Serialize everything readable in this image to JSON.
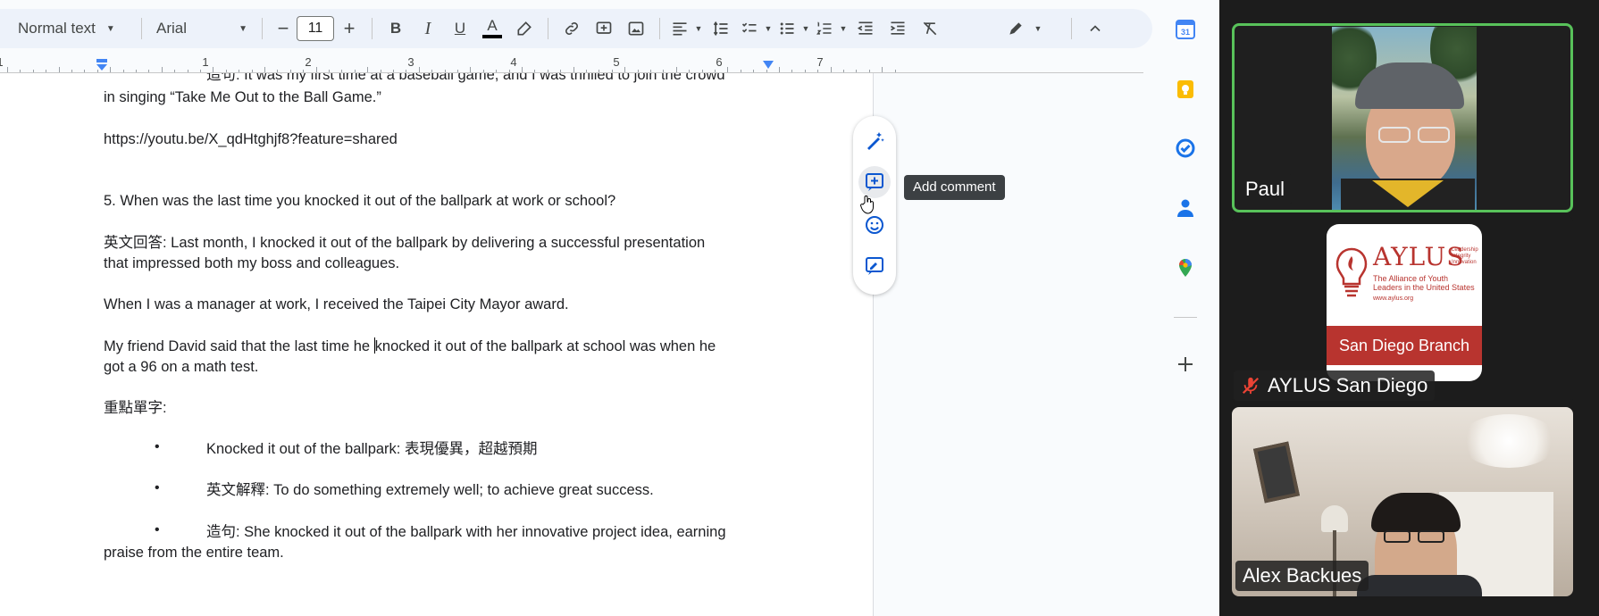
{
  "toolbar": {
    "style": "Normal text",
    "font": "Arial",
    "font_size": "11",
    "decrease": "−",
    "increase": "+",
    "bold": "B",
    "italic": "I",
    "underline": "U",
    "text_color_glyph": "A",
    "icons": [
      "bold-icon",
      "italic-icon",
      "underline-icon",
      "text-color-icon",
      "highlight-icon",
      "link-icon",
      "insert-comment-icon",
      "insert-image-icon",
      "align-icon",
      "line-spacing-icon",
      "checklist-icon",
      "bullet-list-icon",
      "numbered-list-icon",
      "decrease-indent-icon",
      "increase-indent-icon",
      "clear-formatting-icon",
      "editing-mode-icon",
      "collapse-toolbar-icon"
    ],
    "text_color": "#000000"
  },
  "ruler": {
    "numbers": [
      "1",
      "1",
      "2",
      "3",
      "4",
      "5",
      "6",
      "7"
    ]
  },
  "document": {
    "line_top_cut": "造句: It was my first time at a baseball game, and I was thrilled to join the crowd",
    "line_1": "in singing “Take Me Out to the Ball Game.”",
    "link": "https://youtu.be/X_qdHtghjf8?feature=shared",
    "question": "5. When was the last time you knocked it out of the ballpark at work or school?",
    "answer_a": "英文回答: Last month, I knocked it out of the ballpark by delivering a successful presentation",
    "answer_b": "that impressed both my boss and colleagues.",
    "manager": "When I was a manager at work, I received the Taipei City Mayor award.",
    "friend_a1": "My friend David said that the last time he ",
    "friend_a2": "knocked it out of the ballpark at school was when he",
    "friend_b": "got a 96 on a math test.",
    "vocab_heading": "重點單字:",
    "bullet": "•",
    "vocab_1": "Knocked it out of the ballpark: 表現優異，超越預期",
    "vocab_2": "英文解釋: To do something extremely well; to achieve great success.",
    "vocab_3a": "造句: She knocked it out of the ballpark with her innovative project idea, earning",
    "vocab_3b": "praise from the entire team."
  },
  "side_tools": {
    "icons": [
      "help-me-write-icon",
      "add-comment-icon",
      "emoji-reaction-icon",
      "suggest-edits-icon"
    ],
    "tooltip": "Add comment"
  },
  "rail": {
    "icons": [
      "calendar-icon",
      "keep-icon",
      "tasks-icon",
      "contacts-icon",
      "maps-icon",
      "add-icon"
    ],
    "calendar_date": "31"
  },
  "video": {
    "tiles": [
      {
        "name": "Paul",
        "active": true
      },
      {
        "name": "AYLUS San Diego",
        "muted": true
      },
      {
        "name": "Alex Backues"
      }
    ],
    "aylus_logo": {
      "title": "AYLUS",
      "tagline": "Leadership Integrity Innovation",
      "subtitle": "The Alliance of Youth Leaders in the United States",
      "url": "www.aylus.org",
      "branch": "San Diego Branch",
      "color": "#b8342f"
    },
    "active_border_color": "#58c25a"
  }
}
